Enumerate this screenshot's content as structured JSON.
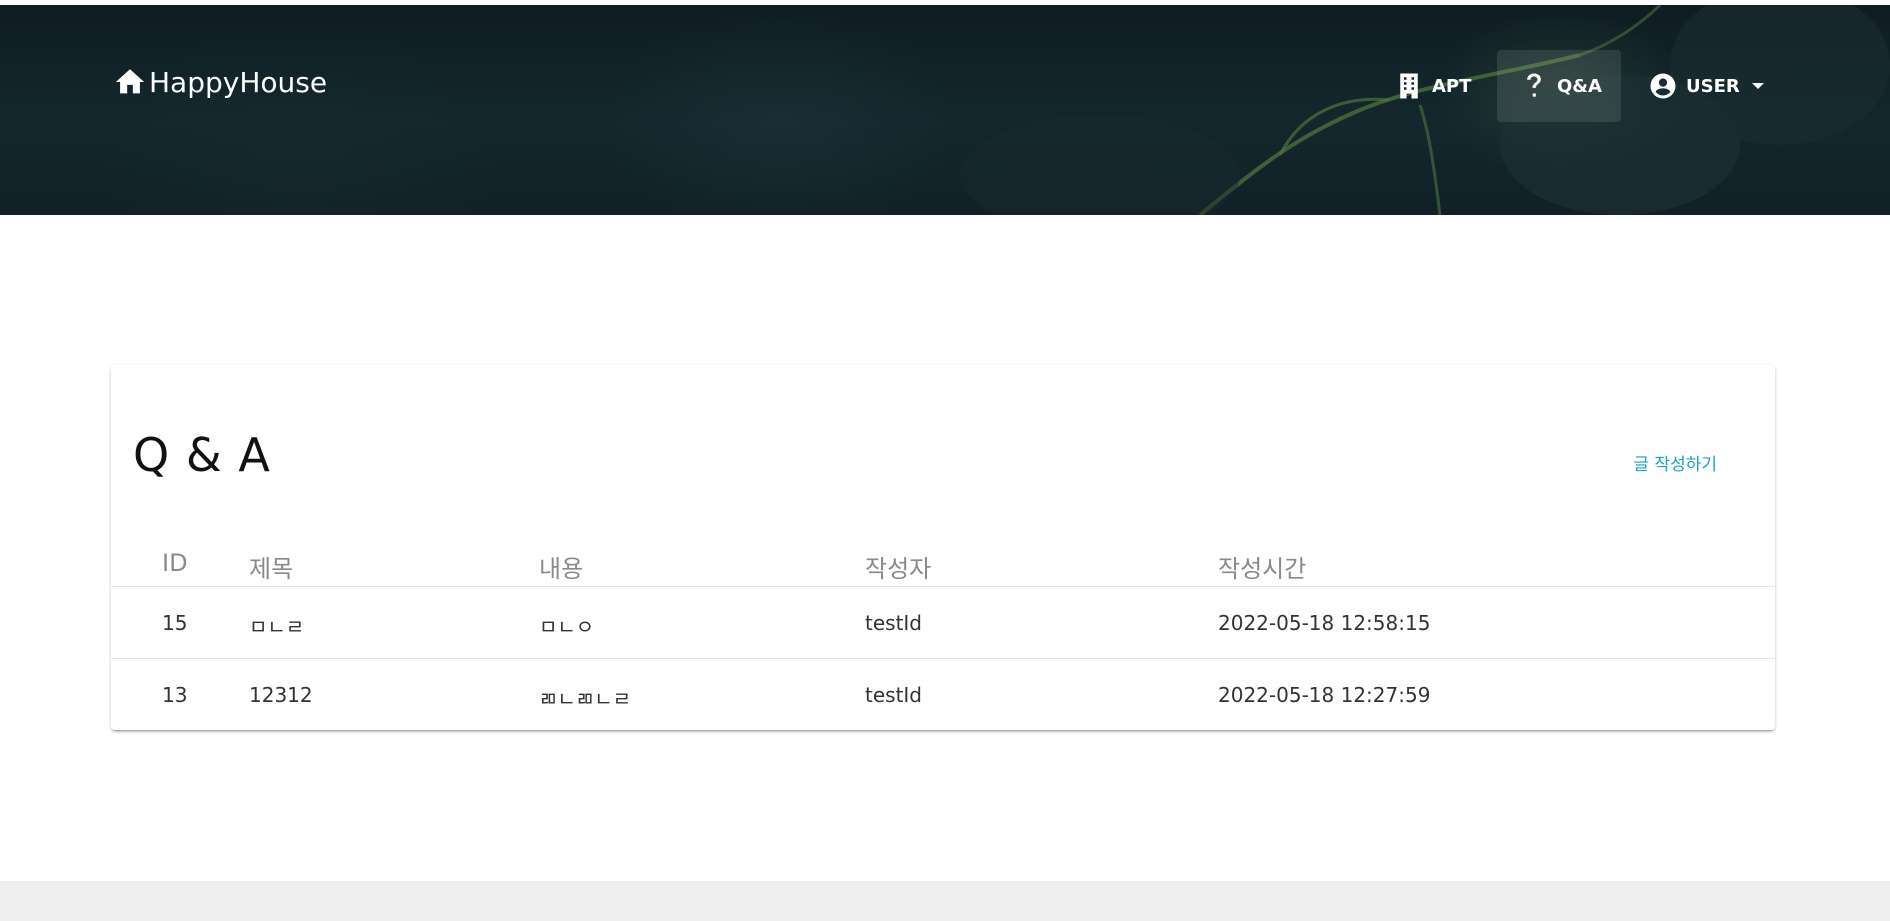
{
  "app": {
    "brand": "HappyHouse"
  },
  "nav": {
    "items": [
      {
        "label": "APT",
        "icon": "building-icon"
      },
      {
        "label": "Q&A",
        "icon": "question-icon",
        "active": true
      },
      {
        "label": "USER",
        "icon": "account-circle-icon",
        "dropdown": true
      }
    ]
  },
  "qna": {
    "title": "Q & A",
    "write_button": "글 작성하기",
    "columns": [
      "ID",
      "제목",
      "내용",
      "작성자",
      "작성시간"
    ],
    "rows": [
      {
        "id": "15",
        "title": "ㅁㄴㄹ",
        "content": "ㅁㄴㅇ",
        "writer": "testId",
        "time": "2022-05-18 12:58:15"
      },
      {
        "id": "13",
        "title": "12312",
        "content": "ㄻㄴㄻㄴㄹ",
        "writer": "testId",
        "time": "2022-05-18 12:27:59"
      }
    ]
  }
}
